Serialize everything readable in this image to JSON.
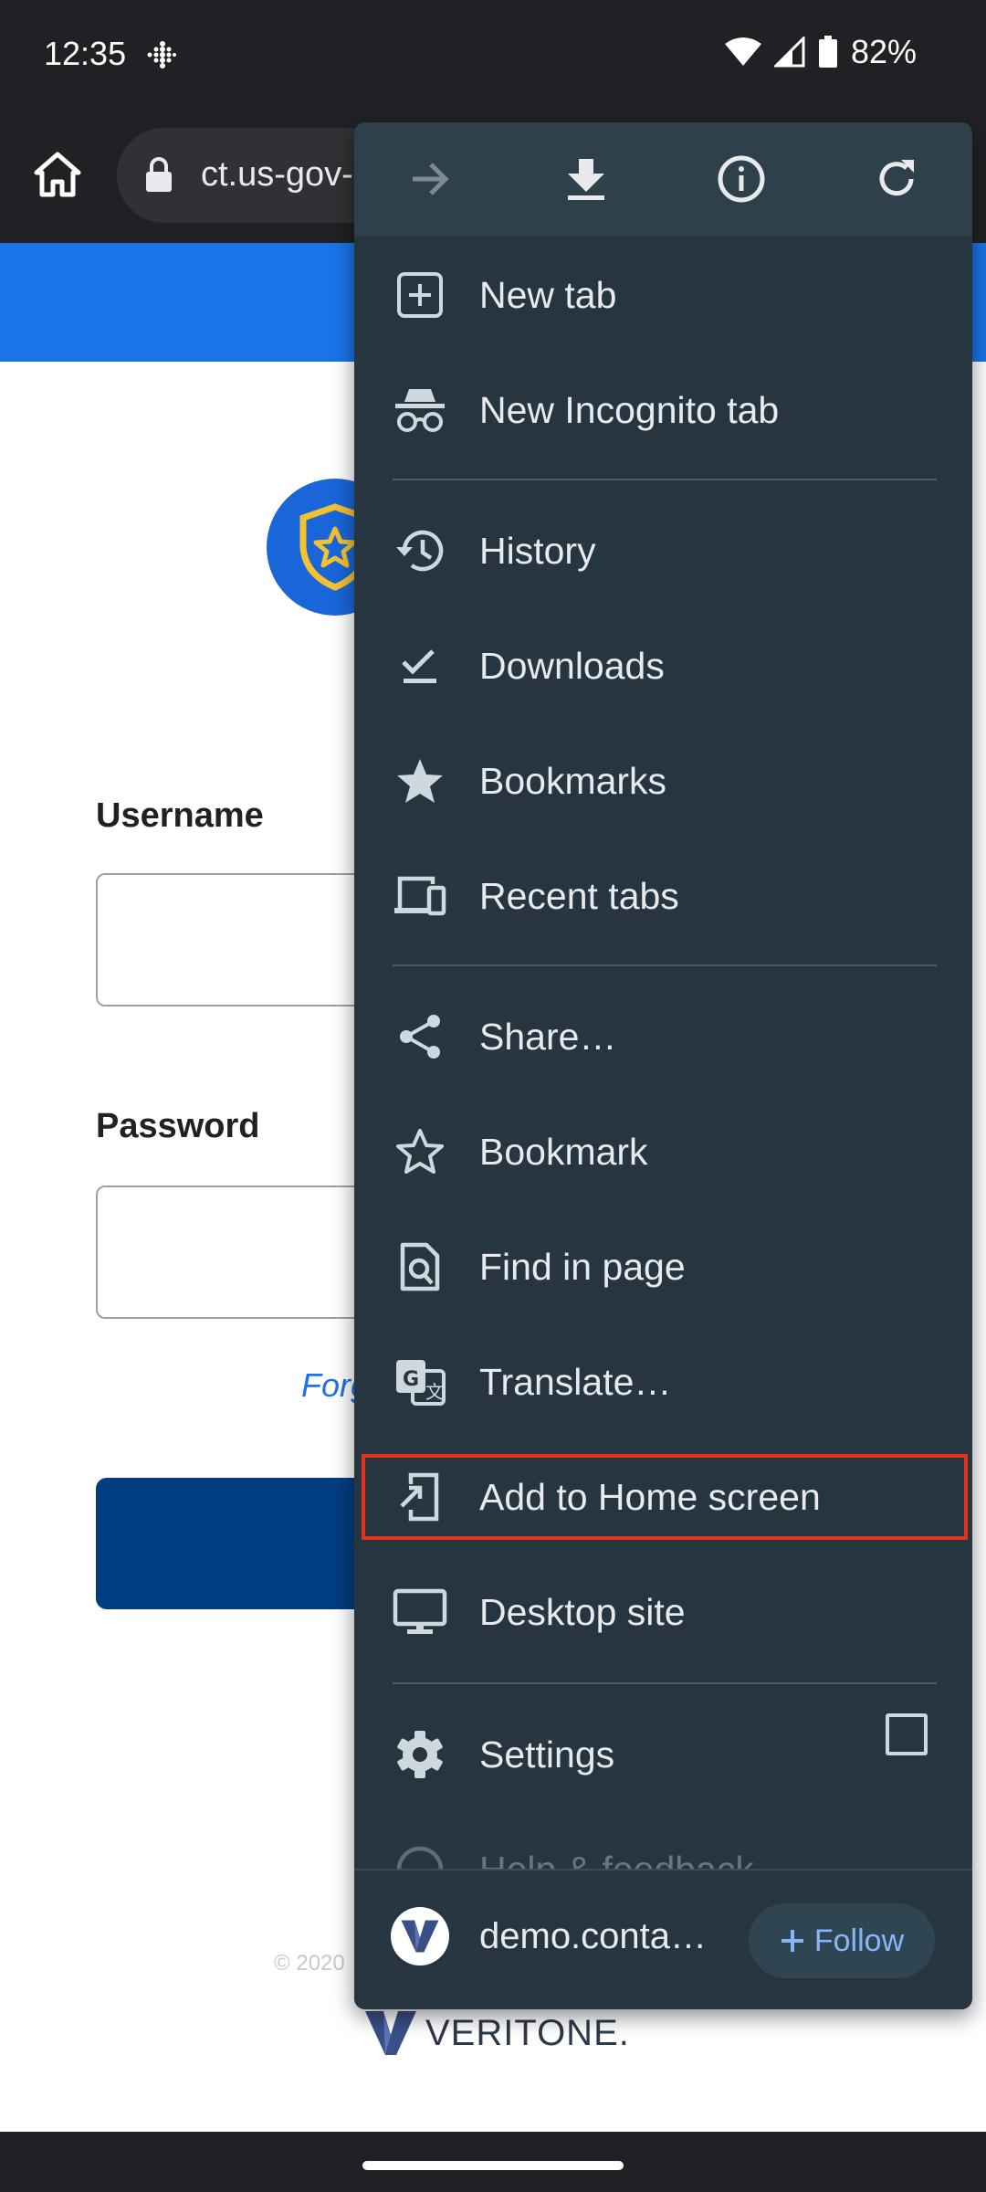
{
  "status_bar": {
    "time": "12:35",
    "battery": "82%"
  },
  "browser": {
    "url": "ct.us-gov-"
  },
  "page": {
    "username_label": "Username",
    "password_label": "Password",
    "forgot_text": "Forg",
    "copyright": "© 2020",
    "brand": "VERITONE."
  },
  "menu": {
    "top_icons": [
      "forward-icon",
      "download-icon",
      "info-icon",
      "refresh-icon"
    ],
    "items": [
      {
        "label": "New tab",
        "icon": "new-tab-icon"
      },
      {
        "label": "New Incognito tab",
        "icon": "incognito-icon"
      },
      {
        "label": "History",
        "icon": "history-icon"
      },
      {
        "label": "Downloads",
        "icon": "downloads-icon"
      },
      {
        "label": "Bookmarks",
        "icon": "bookmarks-icon"
      },
      {
        "label": "Recent tabs",
        "icon": "recent-tabs-icon"
      },
      {
        "label": "Share…",
        "icon": "share-icon"
      },
      {
        "label": "Bookmark",
        "icon": "bookmark-star-icon"
      },
      {
        "label": "Find in page",
        "icon": "find-in-page-icon"
      },
      {
        "label": "Translate…",
        "icon": "translate-icon"
      },
      {
        "label": "Add to Home screen",
        "icon": "add-to-home-icon",
        "highlighted": true
      },
      {
        "label": "Desktop site",
        "icon": "desktop-icon",
        "checked": false
      },
      {
        "label": "Settings",
        "icon": "settings-icon"
      },
      {
        "label": "Help & feedback",
        "icon": "help-icon"
      }
    ],
    "footer": {
      "site": "demo.conta…",
      "follow_label": "Follow"
    }
  },
  "colors": {
    "menu_bg": "#263540",
    "highlight": "#e5321f",
    "accent": "#8ab4f8",
    "page_blue": "#1a73e8"
  }
}
